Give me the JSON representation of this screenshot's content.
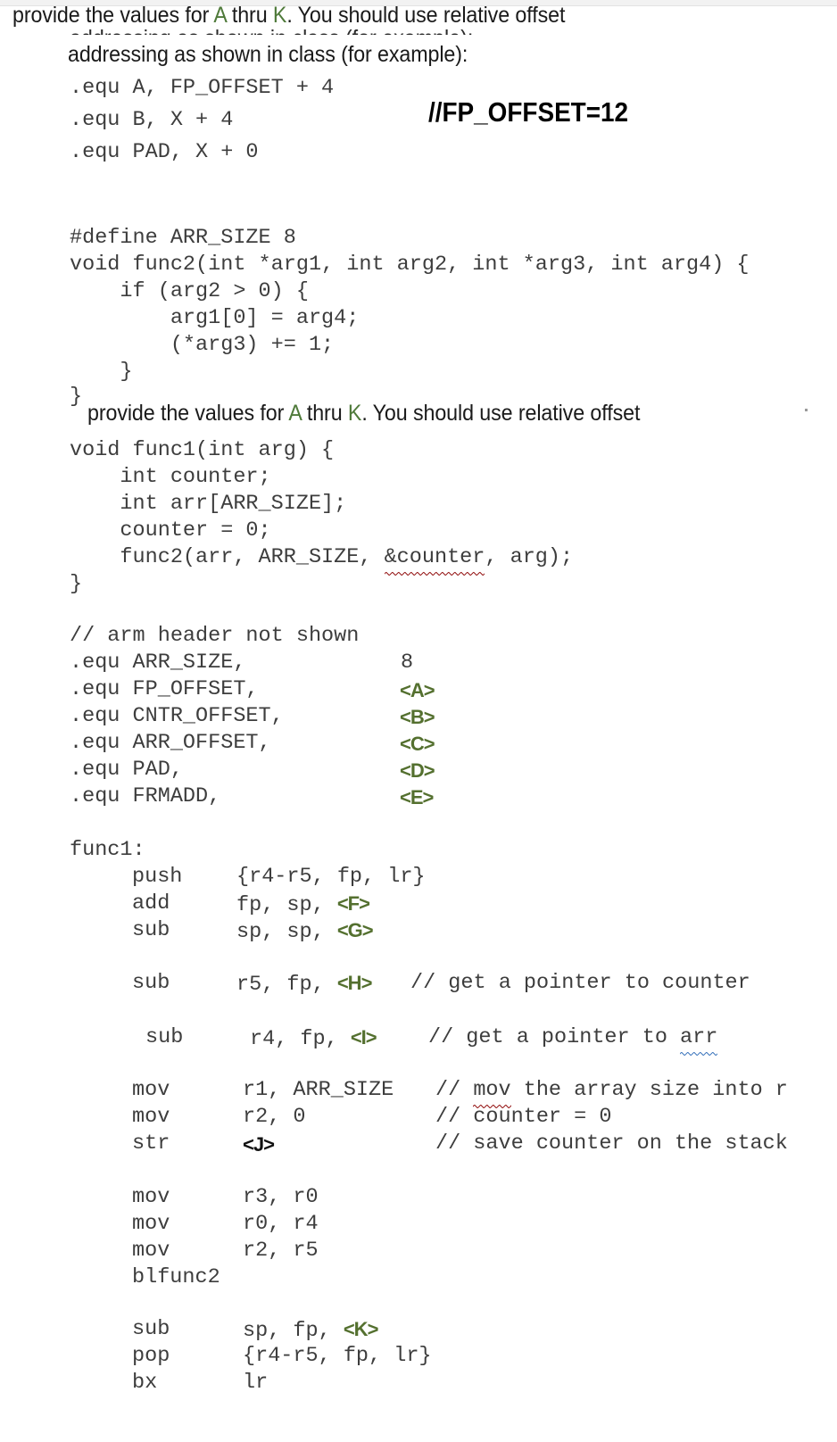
{
  "document": {
    "kind": "assignment-handout",
    "top_strip_visible": true,
    "prose": {
      "instruction_line_1": "provide the values for ",
      "instruction_ph_a": "A",
      "instruction_mid": " thru ",
      "instruction_ph_k": "K",
      "instruction_tail": ". You should use relative offset",
      "instruction_full": "provide the values for A thru K. You should use relative offset",
      "addressing_line": "addressing as shown in class (for example):",
      "ghost_line": "addressing as shown in class (for example):"
    },
    "note": {
      "fp_offset_comment": "//FP_OFFSET=12"
    },
    "example_equ": [
      ".equ A, FP_OFFSET + 4",
      ".equ B, X + 4",
      ".equ PAD, X + 0"
    ],
    "c_code_func2": [
      "#define ARR_SIZE 8",
      "void func2(int *arg1, int arg2, int *arg3, int arg4) {",
      "    if (arg2 > 0) {",
      "        arg1[0] = arg4;",
      "        (*arg3) += 1;",
      "    }",
      "}"
    ],
    "c_code_func1": {
      "line_signature": "void func1(int arg) {",
      "line_counter_decl": "    int counter;",
      "line_arr_decl": "    int arr[ARR_SIZE];",
      "line_counter_init": "    counter = 0;",
      "line_call_pre": "    func2(arr, ARR_SIZE, ",
      "line_call_squiggle": "&counter",
      "line_call_post": ", arg);",
      "line_close": "}"
    },
    "asm_header_comment": "// arm header not shown",
    "equ_table": {
      "rows": [
        {
          "directive": ".equ ARR_SIZE,",
          "value": "8",
          "is_placeholder": false
        },
        {
          "directive": ".equ FP_OFFSET,",
          "value": "<A>",
          "is_placeholder": true
        },
        {
          "directive": ".equ CNTR_OFFSET,",
          "value": "<B>",
          "is_placeholder": true
        },
        {
          "directive": ".equ ARR_OFFSET,",
          "value": "<C>",
          "is_placeholder": true
        },
        {
          "directive": ".equ PAD,",
          "value": "<D>",
          "is_placeholder": true
        },
        {
          "directive": ".equ FRMADD,",
          "value": "<E>",
          "is_placeholder": true
        }
      ]
    },
    "asm_label": "func1:",
    "asm_lines": {
      "push": {
        "mnemonic": "push",
        "operands": "{r4-r5, fp, lr}"
      },
      "add_fp": {
        "mnemonic": "add",
        "operands_pre": "fp, sp, ",
        "placeholder": "<F>"
      },
      "sub_sp": {
        "mnemonic": "sub",
        "operands_pre": "sp, sp, ",
        "placeholder": "<G>"
      },
      "sub_r5": {
        "mnemonic": "sub",
        "operands_pre": "r5, fp, ",
        "placeholder": "<H>",
        "comment": "// get a pointer to counter"
      },
      "sub_r4": {
        "mnemonic": "sub",
        "operands_pre": "r4, fp, ",
        "placeholder": "<I>",
        "comment_pre": "// get a pointer to ",
        "comment_squiggle": "arr"
      },
      "mov_r1": {
        "mnemonic": "mov",
        "operands": "r1, ARR_SIZE ",
        "comment_pre": "// ",
        "comment_squiggle": "mov",
        "comment_post": " the array size into r"
      },
      "mov_r2": {
        "mnemonic": "mov",
        "operands": "r2, 0",
        "comment": "// counter = 0"
      },
      "str_j": {
        "mnemonic": "str",
        "placeholder": "<J>",
        "comment": "// save counter on the stack"
      },
      "mov_r3": {
        "mnemonic": "mov",
        "operands": "r3, r0"
      },
      "mov_r0": {
        "mnemonic": "mov",
        "operands": "r0, r4"
      },
      "mov_r2b": {
        "mnemonic": "mov",
        "operands": "r2, r5"
      },
      "bl": {
        "mnemonic": "blfunc2"
      },
      "sub_k": {
        "mnemonic": "sub",
        "operands_pre": "sp, fp, ",
        "placeholder": "<K>"
      },
      "pop": {
        "mnemonic": "pop",
        "operands": "{r4-r5, fp, lr}"
      },
      "bx": {
        "mnemonic": "bx",
        "operands": "lr"
      }
    },
    "colors": {
      "placeholder_green": "#54702f",
      "prose_placeholder_green": "#4f7a3a",
      "code_grey": "#3d3d3d",
      "spell_red": "#9b2323",
      "grammar_blue": "#4a7fc1",
      "page_background": "#ffffff"
    }
  }
}
